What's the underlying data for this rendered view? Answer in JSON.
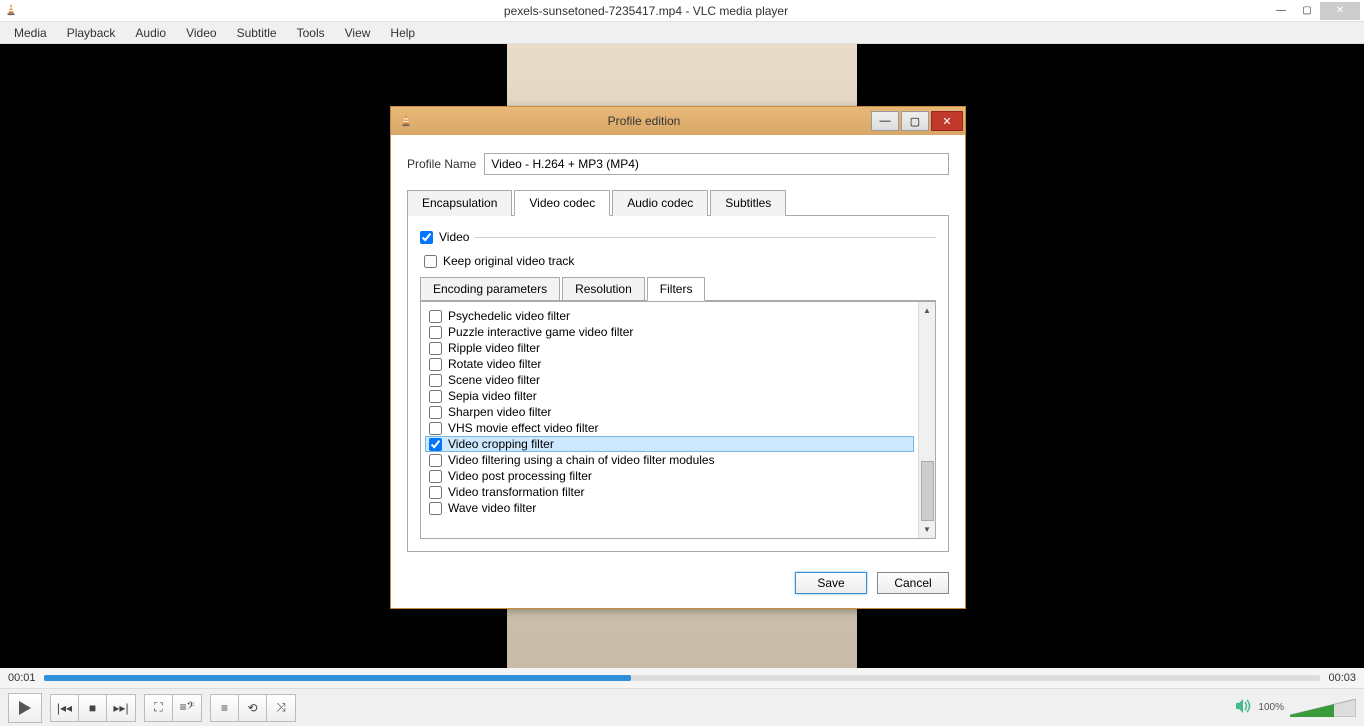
{
  "app": {
    "title": "pexels-sunsetoned-7235417.mp4 - VLC media player",
    "menus": [
      "Media",
      "Playback",
      "Audio",
      "Video",
      "Subtitle",
      "Tools",
      "View",
      "Help"
    ]
  },
  "playback": {
    "current_time": "00:01",
    "total_time": "00:03",
    "volume_pct": "100%"
  },
  "dialog": {
    "title": "Profile edition",
    "profile_name_label": "Profile Name",
    "profile_name_value": "Video - H.264 + MP3 (MP4)",
    "tabs": [
      "Encapsulation",
      "Video codec",
      "Audio codec",
      "Subtitles"
    ],
    "active_tab": 1,
    "video_label": "Video",
    "video_checked": true,
    "keep_track_label": "Keep original video track",
    "keep_track_checked": false,
    "subtabs": [
      "Encoding parameters",
      "Resolution",
      "Filters"
    ],
    "active_subtab": 2,
    "filters": [
      {
        "label": "Psychedelic video filter",
        "checked": false,
        "selected": false
      },
      {
        "label": "Puzzle interactive game video filter",
        "checked": false,
        "selected": false
      },
      {
        "label": "Ripple video filter",
        "checked": false,
        "selected": false
      },
      {
        "label": "Rotate video filter",
        "checked": false,
        "selected": false
      },
      {
        "label": "Scene video filter",
        "checked": false,
        "selected": false
      },
      {
        "label": "Sepia video filter",
        "checked": false,
        "selected": false
      },
      {
        "label": "Sharpen video filter",
        "checked": false,
        "selected": false
      },
      {
        "label": "VHS movie effect video filter",
        "checked": false,
        "selected": false
      },
      {
        "label": "Video cropping filter",
        "checked": true,
        "selected": true
      },
      {
        "label": "Video filtering using a chain of video filter modules",
        "checked": false,
        "selected": false
      },
      {
        "label": "Video post processing filter",
        "checked": false,
        "selected": false
      },
      {
        "label": "Video transformation filter",
        "checked": false,
        "selected": false
      },
      {
        "label": "Wave video filter",
        "checked": false,
        "selected": false
      }
    ],
    "save_label": "Save",
    "cancel_label": "Cancel"
  }
}
